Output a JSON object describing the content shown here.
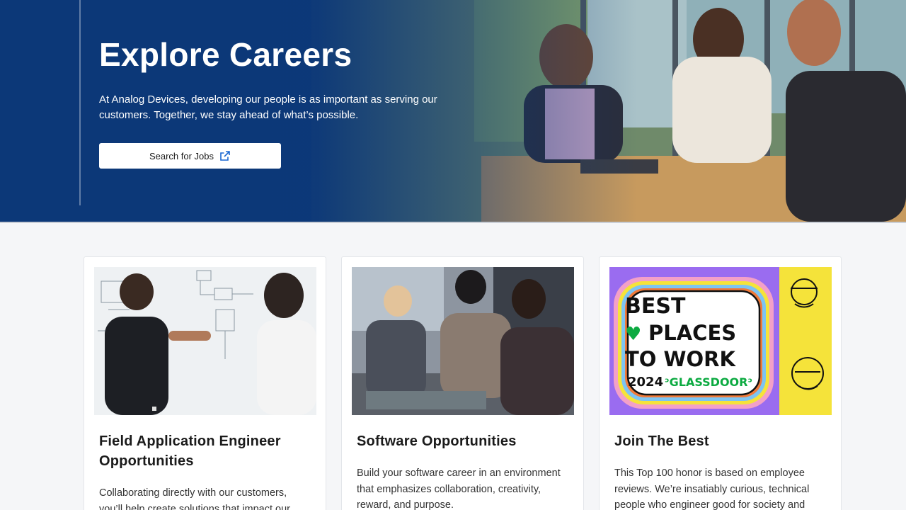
{
  "hero": {
    "title": "Explore Careers",
    "description": "At Analog Devices, developing our people is as important as serving our customers. Together, we stay ahead of what’s possible.",
    "button_label": "Search for Jobs",
    "button_icon": "external-link-icon"
  },
  "cards": [
    {
      "title": "Field Application Engineer Opportunities",
      "text": "Collaborating directly with our customers, you’ll help create solutions that impact our"
    },
    {
      "title": "Software Opportunities",
      "text": "Build your software career in an environment that emphasizes collaboration, creativity, reward, and purpose."
    },
    {
      "title": "Join The Best",
      "text": "This Top 100 honor is based on employee reviews. We’re insatiably curious, technical people who engineer good for society and",
      "badge": {
        "line1": "BEST",
        "line2": "PLACES",
        "line3": "TO WORK",
        "year": "2024",
        "brand": "ᵓGLASSDOORᵓ"
      }
    }
  ],
  "colors": {
    "hero_blue": "#0c3a78",
    "accent_blue": "#1967d2",
    "badge_yellow": "#f5e33a",
    "badge_purple": "#9a6cf0",
    "badge_green": "#0caa41"
  }
}
